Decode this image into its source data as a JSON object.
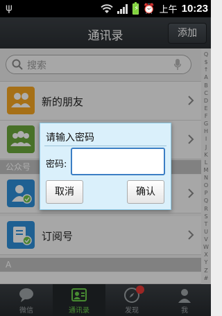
{
  "status_bar": {
    "time_label": "上午",
    "time": "10:23",
    "battery_icon": "battery-charging-icon",
    "usb_icon": "usb-icon"
  },
  "header": {
    "title": "通讯录",
    "add_label": "添加"
  },
  "search": {
    "placeholder": "搜索"
  },
  "list": {
    "items": [
      {
        "label": "新的朋友",
        "icon": "new-friends-icon",
        "color": "#f5a623"
      },
      {
        "label": "",
        "icon": "group-chat-icon",
        "color": "#6aa73b"
      }
    ],
    "section_public": "公众号",
    "public_items": [
      {
        "label": "",
        "icon": "official-account-icon",
        "color": "#2f8ed8"
      },
      {
        "label": "订阅号",
        "icon": "subscription-icon",
        "color": "#2f8ed8"
      }
    ],
    "section_a": "A"
  },
  "index_letters": [
    "Q",
    "$",
    "↑",
    "A",
    "B",
    "C",
    "D",
    "E",
    "F",
    "G",
    "H",
    "I",
    "J",
    "K",
    "L",
    "M",
    "N",
    "O",
    "P",
    "Q",
    "R",
    "S",
    "T",
    "U",
    "V",
    "W",
    "X",
    "Y",
    "Z",
    "#"
  ],
  "bottom_nav": {
    "tabs": [
      {
        "label": "微信",
        "icon": "chat-bubble-icon"
      },
      {
        "label": "通讯录",
        "icon": "contacts-icon"
      },
      {
        "label": "发现",
        "icon": "compass-icon"
      },
      {
        "label": "我",
        "icon": "person-icon"
      }
    ],
    "active": "通讯录"
  },
  "dialog": {
    "title": "请输入密码",
    "password_label": "密码:",
    "password_value": "",
    "cancel_label": "取消",
    "ok_label": "确认"
  },
  "colors": {
    "active_green": "#6bcf4a",
    "dialog_bg": "#daf0fb",
    "field_border": "#3b7ec4",
    "badge_red": "#e53935"
  }
}
